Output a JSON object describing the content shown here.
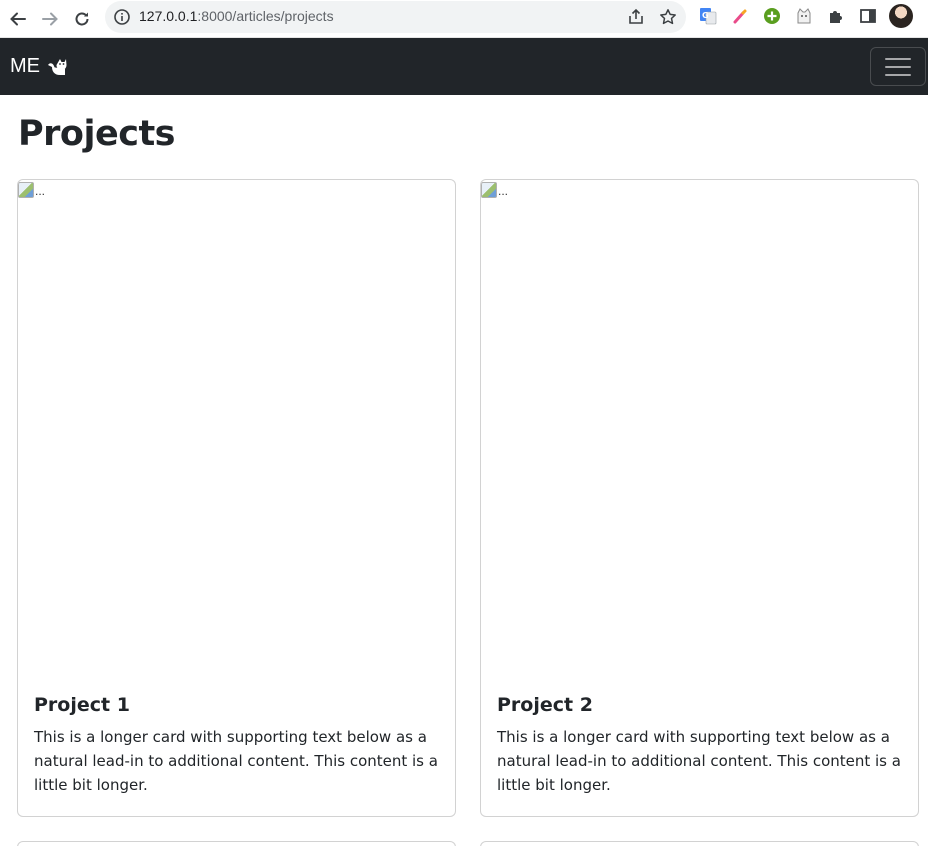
{
  "browser": {
    "url_host": "127.0.0.1",
    "url_rest": ":8000/articles/projects"
  },
  "navbar": {
    "brand_text": "ME"
  },
  "page": {
    "title": "Projects"
  },
  "cards": [
    {
      "image_alt": "...",
      "title": "Project 1",
      "text": "This is a longer card with supporting text below as a natural lead-in to additional content. This content is a little bit longer."
    },
    {
      "image_alt": "...",
      "title": "Project 2",
      "text": "This is a longer card with supporting text below as a natural lead-in to additional content. This content is a little bit longer."
    }
  ],
  "icons": {
    "back": "back-arrow-icon",
    "forward": "forward-arrow-icon",
    "reload": "reload-icon",
    "site_info": "info-icon",
    "share": "share-icon",
    "bookmark": "star-icon",
    "extensions": [
      "google-translate-icon",
      "color-picker-icon",
      "green-plus-icon",
      "cat-extension-icon",
      "puzzle-icon",
      "side-panel-icon"
    ],
    "brand_logo": "cat-icon",
    "menu": "hamburger-icon"
  },
  "colors": {
    "navbar_bg": "#212529",
    "text": "#212529",
    "card_border": "rgba(0,0,0,0.175)"
  }
}
